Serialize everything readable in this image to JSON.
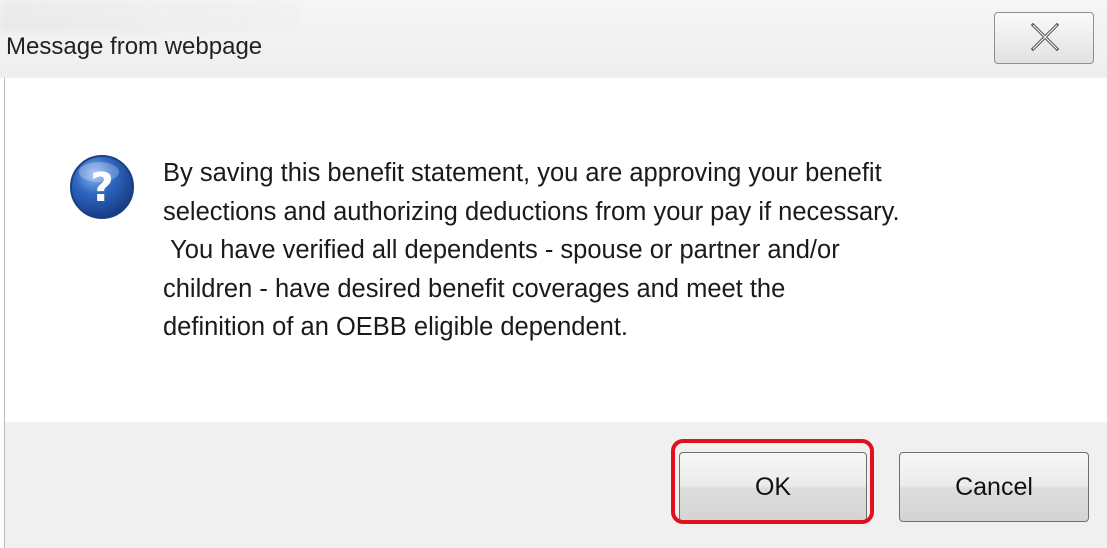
{
  "window": {
    "title": "Message from webpage"
  },
  "icons": {
    "close": "close-x-icon",
    "message": "question-icon"
  },
  "message": {
    "text": "By saving this benefit statement, you are approving your benefit\nselections and authorizing deductions from your pay if necessary.\n You have verified all dependents - spouse or partner and/or\nchildren - have desired benefit coverages and meet the\ndefinition of an OEBB eligible dependent."
  },
  "buttons": {
    "ok_label": "OK",
    "cancel_label": "Cancel"
  },
  "colors": {
    "highlight": "#e0101e",
    "question_icon": "#2a5fb0",
    "footer_bg": "#f0f0f0"
  }
}
